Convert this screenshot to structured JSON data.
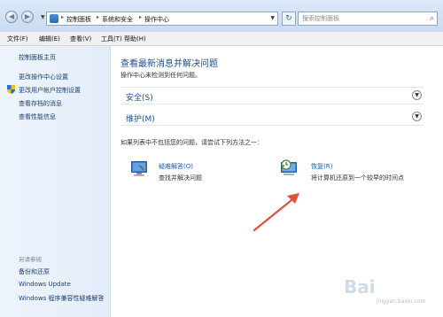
{
  "address_bar": {
    "breadcrumbs": [
      "控制面板",
      "系统和安全",
      "操作中心"
    ],
    "search_placeholder": "搜索控制面板"
  },
  "menu": [
    "文件(F)",
    "编辑(E)",
    "查看(V)",
    "工具(T)",
    "帮助(H)"
  ],
  "sidebar": {
    "home": "控制面板主页",
    "links": [
      "更改操作中心设置",
      "更改用户帐户控制设置",
      "查看存档的消息",
      "查看性能信息"
    ],
    "see_also_header": "另请参阅",
    "see_also": [
      "备份和还原",
      "Windows Update",
      "Windows 程序兼容性疑难解答"
    ]
  },
  "main": {
    "title": "查看最新消息并解决问题",
    "subtitle": "操作中心未检测到任何问题。",
    "sections": [
      {
        "label": "安全(S)"
      },
      {
        "label": "维护(M)"
      }
    ],
    "cant_find": "如果列表中不包括您的问题，请尝试下列方法之一：",
    "tools": [
      {
        "title": "疑难解答(O)",
        "desc": "查找并解决问题"
      },
      {
        "title": "恢复(R)",
        "desc": "将计算机还原到一个较早的时间点"
      }
    ]
  },
  "watermark": {
    "text": "Bai",
    "sub": "jingyan.baidu.com"
  },
  "colors": {
    "link": "#1a5bb3",
    "title": "#1e4f93",
    "annotation_arrow": "#e0503a"
  }
}
